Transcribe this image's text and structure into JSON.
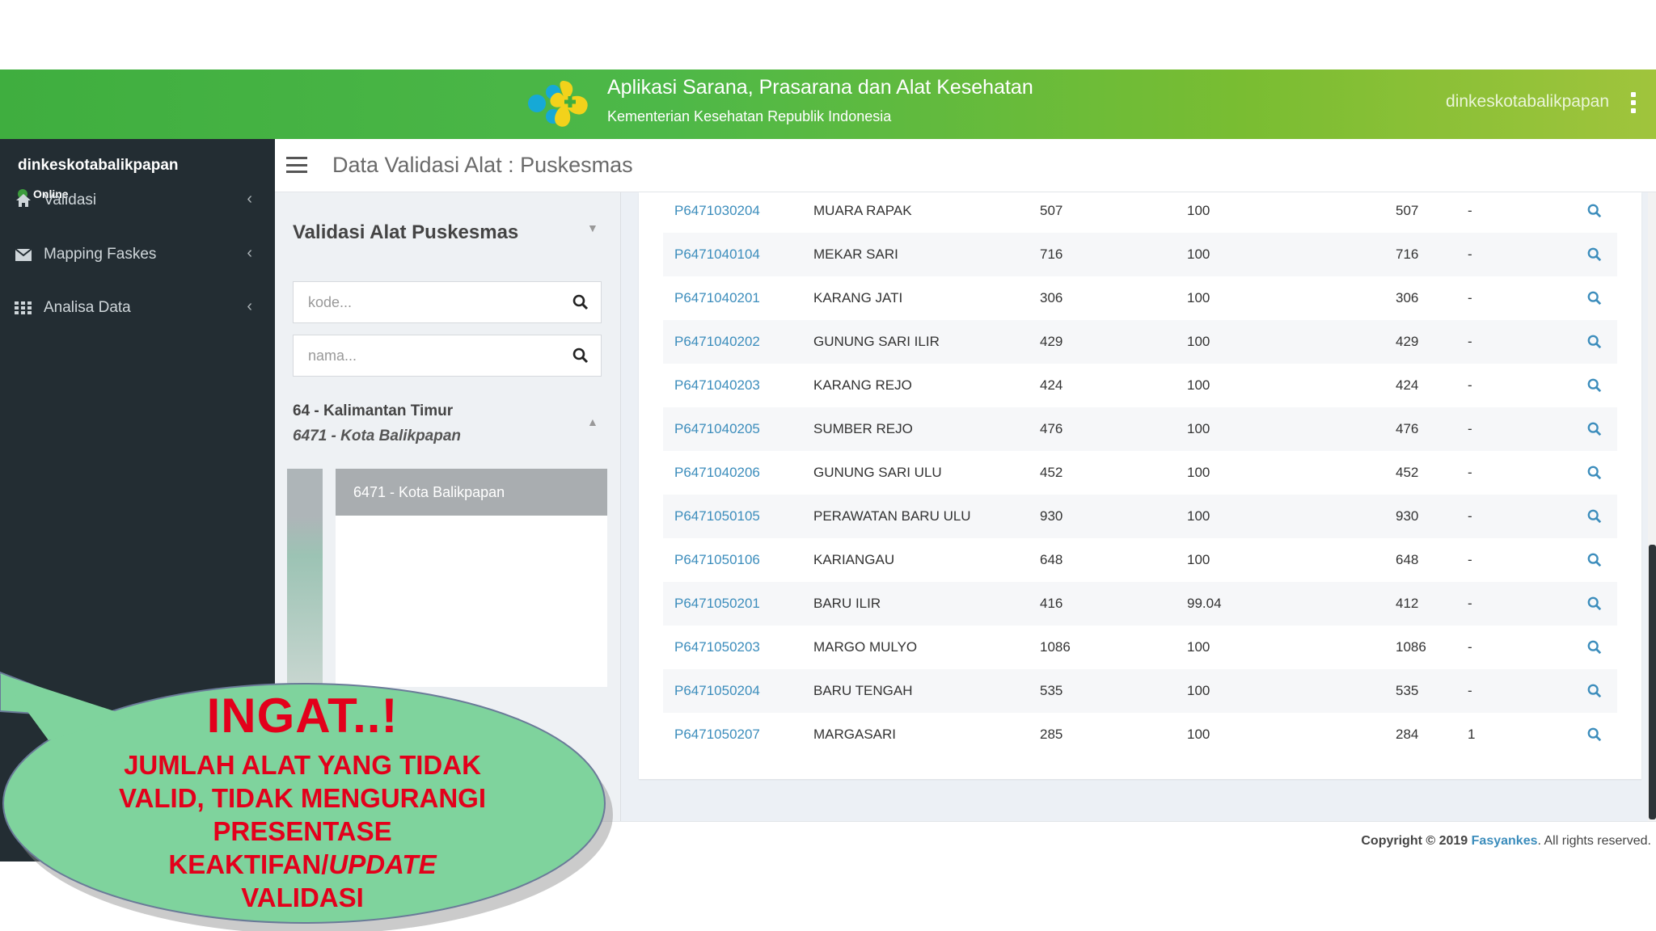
{
  "header": {
    "app_title": "Aplikasi Sarana, Prasarana dan Alat Kesehatan",
    "app_subtitle": "Kementerian Kesehatan Republik Indonesia",
    "username": "dinkeskotabalikpapan",
    "brand_color": "#4db848"
  },
  "sidebar": {
    "username": "dinkeskotabalikpapan",
    "status": "Online",
    "items": [
      {
        "label": "Validasi",
        "icon": "home-icon"
      },
      {
        "label": "Mapping Faskes",
        "icon": "envelope-icon"
      },
      {
        "label": "Analisa Data",
        "icon": "grid-icon"
      }
    ]
  },
  "topbar": {
    "page_title": "Data Validasi Alat : Puskesmas"
  },
  "filter": {
    "title": "Validasi Alat Puskesmas",
    "kode_placeholder": "kode...",
    "nama_placeholder": "nama...",
    "province": "64 - Kalimantan Timur",
    "city": "6471 - Kota Balikpapan",
    "selected_item": "6471 - Kota Balikpapan"
  },
  "table": {
    "rows": [
      {
        "code": "P6471030204",
        "name": "MUARA RAPAK",
        "total": "507",
        "percent": "100",
        "valid": "507",
        "invalid": "-"
      },
      {
        "code": "P6471040104",
        "name": "MEKAR SARI",
        "total": "716",
        "percent": "100",
        "valid": "716",
        "invalid": "-"
      },
      {
        "code": "P6471040201",
        "name": "KARANG JATI",
        "total": "306",
        "percent": "100",
        "valid": "306",
        "invalid": "-"
      },
      {
        "code": "P6471040202",
        "name": "GUNUNG SARI ILIR",
        "total": "429",
        "percent": "100",
        "valid": "429",
        "invalid": "-"
      },
      {
        "code": "P6471040203",
        "name": "KARANG REJO",
        "total": "424",
        "percent": "100",
        "valid": "424",
        "invalid": "-"
      },
      {
        "code": "P6471040205",
        "name": "SUMBER REJO",
        "total": "476",
        "percent": "100",
        "valid": "476",
        "invalid": "-"
      },
      {
        "code": "P6471040206",
        "name": "GUNUNG SARI ULU",
        "total": "452",
        "percent": "100",
        "valid": "452",
        "invalid": "-"
      },
      {
        "code": "P6471050105",
        "name": "PERAWATAN BARU ULU",
        "total": "930",
        "percent": "100",
        "valid": "930",
        "invalid": "-"
      },
      {
        "code": "P6471050106",
        "name": "KARIANGAU",
        "total": "648",
        "percent": "100",
        "valid": "648",
        "invalid": "-"
      },
      {
        "code": "P6471050201",
        "name": "BARU ILIR",
        "total": "416",
        "percent": "99.04",
        "valid": "412",
        "invalid": "-"
      },
      {
        "code": "P6471050203",
        "name": "MARGO MULYO",
        "total": "1086",
        "percent": "100",
        "valid": "1086",
        "invalid": "-"
      },
      {
        "code": "P6471050204",
        "name": "BARU TENGAH",
        "total": "535",
        "percent": "100",
        "valid": "535",
        "invalid": "-"
      },
      {
        "code": "P6471050207",
        "name": "MARGASARI",
        "total": "285",
        "percent": "100",
        "valid": "284",
        "invalid": "1"
      }
    ],
    "link_color": "#3c8dbc"
  },
  "footer": {
    "copyright_prefix": "Copyright © 2019",
    "brand": "Fasyankes",
    "suffix": ". All rights reserved."
  },
  "callout": {
    "title": "INGAT..!",
    "line1": "JUMLAH ALAT YANG TIDAK",
    "line2": "VALID, TIDAK MENGURANGI",
    "line3": "PRESENTASE",
    "line4a": "KEAKTIFAN/",
    "line4b": "UPDATE",
    "line5": "VALIDASI",
    "text_color": "#e3001b",
    "bubble_color": "#7fd39d"
  }
}
